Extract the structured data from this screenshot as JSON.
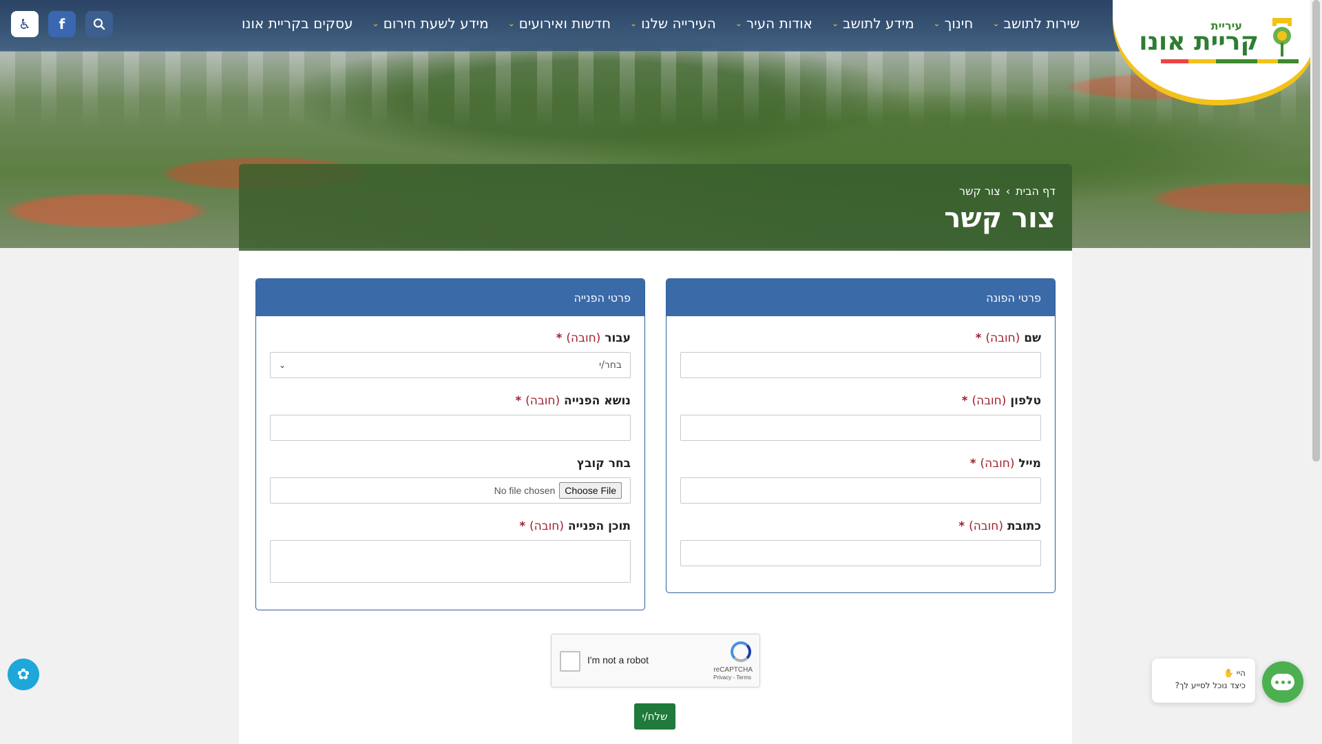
{
  "nav": {
    "items": [
      {
        "label": "שירות לתושב",
        "has_dropdown": true
      },
      {
        "label": "חינוך",
        "has_dropdown": true
      },
      {
        "label": "מידע לתושב",
        "has_dropdown": true
      },
      {
        "label": "אודות העיר",
        "has_dropdown": true
      },
      {
        "label": "העירייה שלנו",
        "has_dropdown": true
      },
      {
        "label": "חדשות ואירועים",
        "has_dropdown": true
      },
      {
        "label": "מידע לשעת חירום",
        "has_dropdown": true
      },
      {
        "label": "עסקים בקריית אונו",
        "has_dropdown": false
      }
    ],
    "accessibility_icon": "accessibility-icon",
    "facebook_icon": "facebook-icon",
    "search_icon": "search-icon"
  },
  "logo": {
    "small": "עיריית",
    "big": "קריית אונו"
  },
  "breadcrumb": {
    "home": "דף הבית",
    "separator": "›",
    "current": "צור קשר"
  },
  "page_title": "צור קשר",
  "requester_box": {
    "header": "פרטי הפונה",
    "fields": [
      {
        "label": "שם",
        "required_text": "(חובה)",
        "star": "*",
        "value": ""
      },
      {
        "label": "טלפון",
        "required_text": "(חובה)",
        "star": "*",
        "value": ""
      },
      {
        "label": "מייל",
        "required_text": "(חובה)",
        "star": "*",
        "value": ""
      },
      {
        "label": "כתובת",
        "required_text": "(חובה)",
        "star": "*",
        "value": ""
      }
    ]
  },
  "request_box": {
    "header": "פרטי הפנייה",
    "to": {
      "label": "עבור",
      "required_text": "(חובה)",
      "star": "*",
      "selected": "בחר/י"
    },
    "subject": {
      "label": "נושא הפנייה",
      "required_text": "(חובה)",
      "star": "*",
      "value": ""
    },
    "file": {
      "label": "בחר קובץ",
      "button": "Choose File",
      "status": "No file chosen"
    },
    "content": {
      "label": "תוכן הפנייה",
      "required_text": "(חובה)",
      "star": "*",
      "value": ""
    }
  },
  "recaptcha": {
    "label": "I'm not a robot",
    "brand": "reCAPTCHA",
    "links": "Privacy - Terms"
  },
  "submit_label": "שלח/י",
  "chat": {
    "greeting": "היי",
    "question": "כיצד נוכל לסייע לך?"
  },
  "colors": {
    "nav_bg": "#2d5078",
    "box_header": "#3b6aa8",
    "required": "#a02030",
    "submit": "#1f7a3c",
    "chat": "#4caf50"
  }
}
